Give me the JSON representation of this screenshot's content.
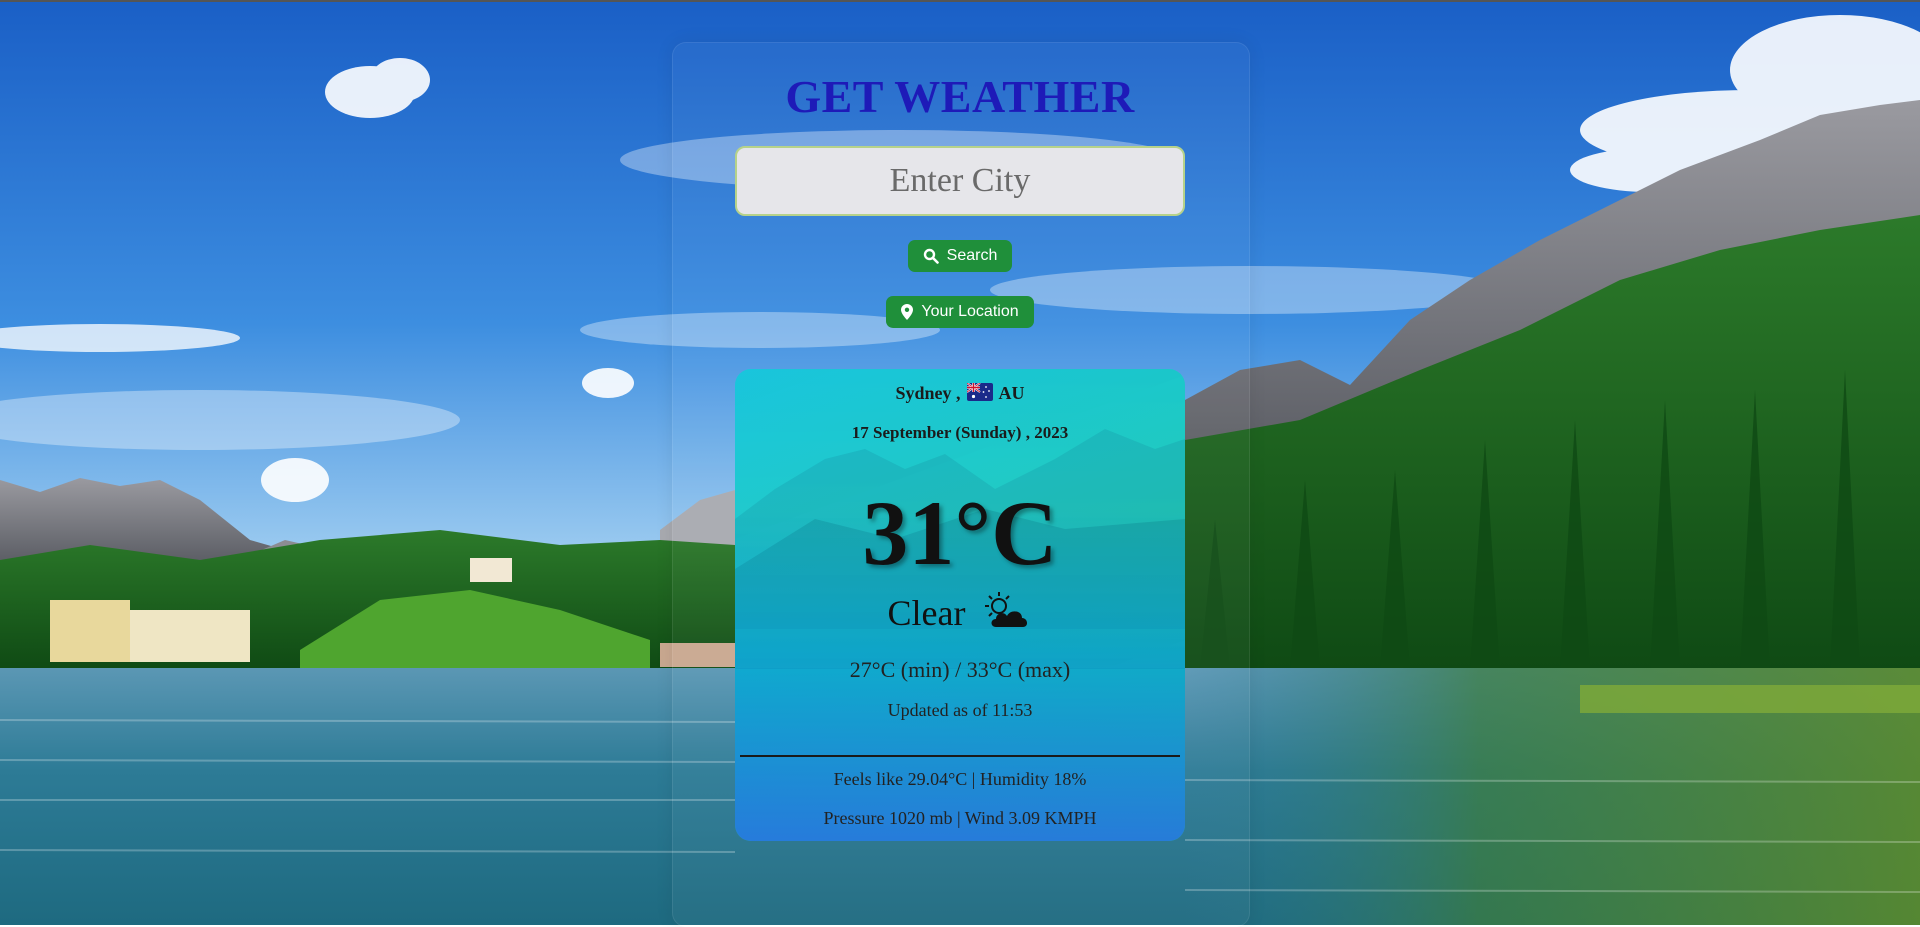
{
  "app": {
    "title": "GET WEATHER"
  },
  "search": {
    "placeholder": "Enter City",
    "value": "",
    "search_label": "Search",
    "search_icon": "search-icon",
    "location_label": "Your Location",
    "location_icon": "map-pin-icon"
  },
  "weather": {
    "city": "Sydney ,",
    "country_code": "AU",
    "country_flag_icon": "australia-flag-icon",
    "date": "17 September (Sunday) , 2023",
    "temperature": "31°C",
    "condition": "Clear",
    "condition_icon": "sun-behind-cloud-icon",
    "min_max": "27°C (min) / 33°C (max)",
    "updated": "Updated as of 11:53",
    "feels_humidity": "Feels like 29.04°C | Humidity 18%",
    "pressure_wind": "Pressure 1020 mb | Wind 3.09 KMPH"
  },
  "colors": {
    "title": "#1e1ab8",
    "button_green": "#1f8f3a",
    "card_gradient_start": "#14c8dc",
    "card_gradient_end": "#1cd28c"
  }
}
